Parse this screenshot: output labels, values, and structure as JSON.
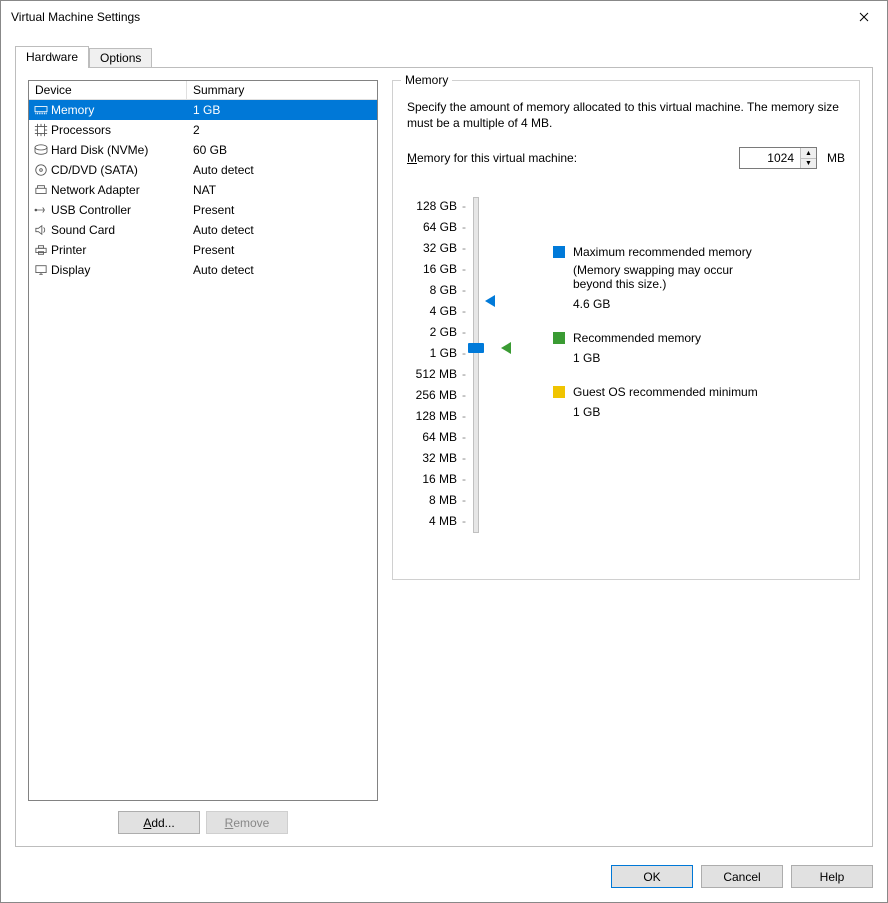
{
  "window": {
    "title": "Virtual Machine Settings"
  },
  "tabs": {
    "hardware": "Hardware",
    "options": "Options"
  },
  "list": {
    "col_device": "Device",
    "col_summary": "Summary",
    "rows": [
      {
        "icon": "memory-icon",
        "device": "Memory",
        "summary": "1 GB"
      },
      {
        "icon": "cpu-icon",
        "device": "Processors",
        "summary": "2"
      },
      {
        "icon": "disk-icon",
        "device": "Hard Disk (NVMe)",
        "summary": "60 GB"
      },
      {
        "icon": "cd-icon",
        "device": "CD/DVD (SATA)",
        "summary": "Auto detect"
      },
      {
        "icon": "network-icon",
        "device": "Network Adapter",
        "summary": "NAT"
      },
      {
        "icon": "usb-icon",
        "device": "USB Controller",
        "summary": "Present"
      },
      {
        "icon": "sound-icon",
        "device": "Sound Card",
        "summary": "Auto detect"
      },
      {
        "icon": "printer-icon",
        "device": "Printer",
        "summary": "Present"
      },
      {
        "icon": "display-icon",
        "device": "Display",
        "summary": "Auto detect"
      }
    ],
    "selected_index": 0,
    "add_label": "Add...",
    "remove_label": "Remove"
  },
  "memory_panel": {
    "legend": "Memory",
    "description": "Specify the amount of memory allocated to this virtual machine. The memory size must be a multiple of 4 MB.",
    "input_label_pre": "M",
    "input_label_post": "emory for this virtual machine:",
    "value": "1024",
    "unit": "MB",
    "ticks": [
      "128 GB",
      "64 GB",
      "32 GB",
      "16 GB",
      "8 GB",
      "4 GB",
      "2 GB",
      "1 GB",
      "512 MB",
      "256 MB",
      "128 MB",
      "64 MB",
      "32 MB",
      "16 MB",
      "8 MB",
      "4 MB"
    ],
    "markers": {
      "max": {
        "label": "Maximum recommended memory",
        "sub": "(Memory swapping may occur beyond this size.)",
        "value": "4.6 GB"
      },
      "rec": {
        "label": "Recommended memory",
        "value": "1 GB"
      },
      "min": {
        "label": "Guest OS recommended minimum",
        "value": "1 GB"
      }
    }
  },
  "buttons": {
    "ok": "OK",
    "cancel": "Cancel",
    "help": "Help"
  }
}
